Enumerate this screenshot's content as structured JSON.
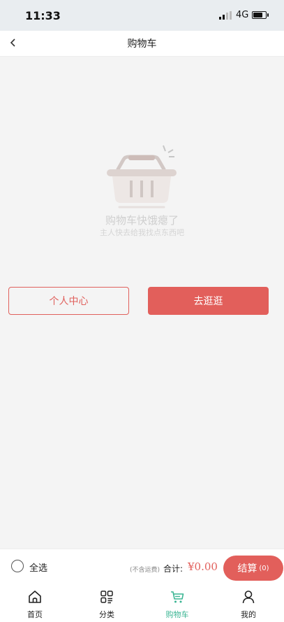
{
  "status_bar": {
    "time": "11:33",
    "network": "4G"
  },
  "header": {
    "title": "购物车"
  },
  "empty_state": {
    "title": "购物车快饿瘪了",
    "subtitle": "主人快去给我找点东西吧"
  },
  "actions": {
    "profile_label": "个人中心",
    "browse_label": "去逛逛"
  },
  "checkout": {
    "select_all_label": "全选",
    "shipping_note": "(不含运费)",
    "total_label": "合计:",
    "total_amount": "¥0.00",
    "checkout_label": "结算",
    "checkout_count": "(0)"
  },
  "tabs": [
    {
      "label": "首页",
      "icon": "home-icon",
      "active": false
    },
    {
      "label": "分类",
      "icon": "category-icon",
      "active": false
    },
    {
      "label": "购物车",
      "icon": "cart-icon",
      "active": true
    },
    {
      "label": "我的",
      "icon": "user-icon",
      "active": false
    }
  ],
  "colors": {
    "accent": "#e25f5b",
    "tab_active": "#3bb593"
  }
}
